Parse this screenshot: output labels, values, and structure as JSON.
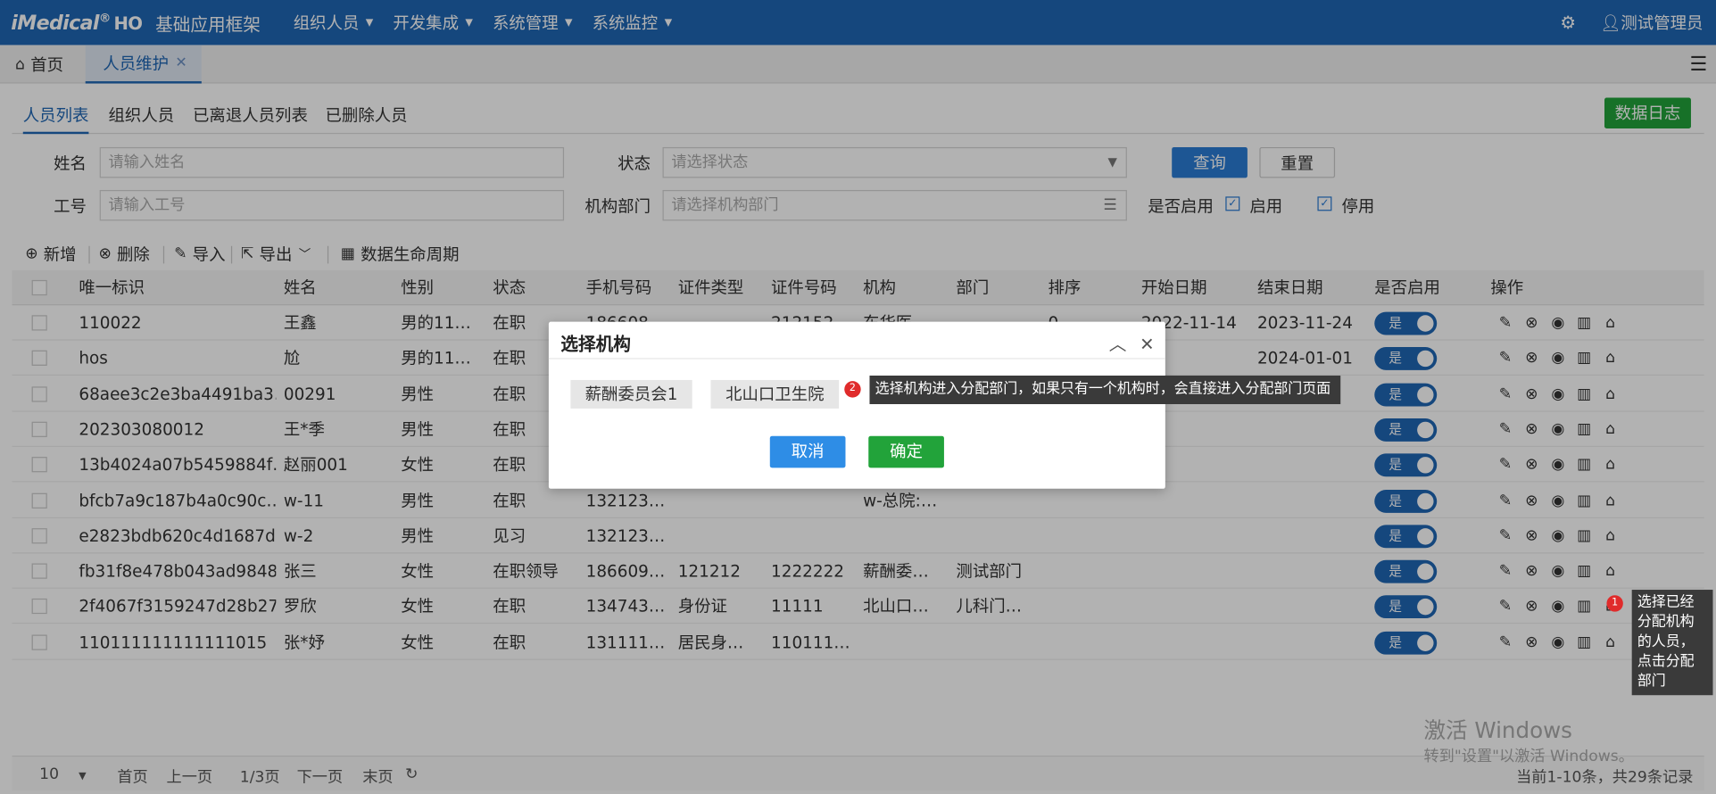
{
  "topbar": {
    "logo": "iMedical",
    "logo_reg": "®",
    "logo_ho": "HO",
    "app_name": "基础应用框架",
    "nav": [
      "组织人员",
      "开发集成",
      "系统管理",
      "系统监控"
    ],
    "user": "测试管理员"
  },
  "tabs": {
    "home": "首页",
    "active": "人员维护"
  },
  "subtabs": [
    "人员列表",
    "组织人员",
    "已离退人员列表",
    "已删除人员"
  ],
  "log_button": "数据日志",
  "search": {
    "name_label": "姓名",
    "name_placeholder": "请输入姓名",
    "status_label": "状态",
    "status_placeholder": "请选择状态",
    "query_button": "查询",
    "reset_button": "重置",
    "job_label": "工号",
    "job_placeholder": "请输入工号",
    "dept_label": "机构部门",
    "dept_placeholder": "请选择机构部门",
    "enabled_label": "是否启用",
    "opt_enabled": "启用",
    "opt_disabled": "停用"
  },
  "toolbar": {
    "add": "新增",
    "delete": "删除",
    "import": "导入",
    "export": "导出",
    "lifecycle": "数据生命周期"
  },
  "columns": [
    "唯一标识",
    "姓名",
    "性别",
    "状态",
    "手机号码",
    "证件类型",
    "证件号码",
    "机构",
    "部门",
    "排序",
    "开始日期",
    "结束日期",
    "是否启用",
    "操作"
  ],
  "rows": [
    {
      "id": "110022",
      "name": "王鑫",
      "gender": "男的11…",
      "status": "在职",
      "phone": "186608",
      "idtype": "",
      "idno": "212152",
      "org": "东华医",
      "dept": "",
      "sort": "0",
      "start": "2022-11-14",
      "end": "2023-11-24",
      "enabled": "是"
    },
    {
      "id": "hos",
      "name": "尬",
      "gender": "男的11…",
      "status": "在职",
      "phone": "",
      "idtype": "",
      "idno": "",
      "org": "",
      "dept": "",
      "sort": "",
      "start": "",
      "end": "2024-01-01",
      "enabled": "是"
    },
    {
      "id": "68aee3c2e3ba4491ba3…",
      "name": "00291",
      "gender": "男性",
      "status": "在职",
      "phone": "",
      "idtype": "",
      "idno": "",
      "org": "",
      "dept": "",
      "sort": "",
      "start": "",
      "end": "",
      "enabled": "是"
    },
    {
      "id": "202303080012",
      "name": "王*季",
      "gender": "男性",
      "status": "在职",
      "phone": "",
      "idtype": "",
      "idno": "",
      "org": "",
      "dept": "",
      "sort": "",
      "start": "",
      "end": "",
      "enabled": "是"
    },
    {
      "id": "13b4024a07b5459884f…",
      "name": "赵丽001",
      "gender": "女性",
      "status": "在职",
      "phone": "",
      "idtype": "",
      "idno": "",
      "org": "",
      "dept": "",
      "sort": "",
      "start": "",
      "end": "",
      "enabled": "是"
    },
    {
      "id": "bfcb7a9c187b4a0c90c…",
      "name": "w-11",
      "gender": "男性",
      "status": "在职",
      "phone": "132123…",
      "idtype": "",
      "idno": "",
      "org": "w-总院:…",
      "dept": "",
      "sort": "",
      "start": "",
      "end": "",
      "enabled": "是"
    },
    {
      "id": "e2823bdb620c4d1687d…",
      "name": "w-2",
      "gender": "男性",
      "status": "见习",
      "phone": "132123…",
      "idtype": "",
      "idno": "",
      "org": "",
      "dept": "",
      "sort": "",
      "start": "",
      "end": "",
      "enabled": "是"
    },
    {
      "id": "fb31f8e478b043ad9848…",
      "name": "张三",
      "gender": "女性",
      "status": "在职领导",
      "phone": "186609…",
      "idtype": "121212",
      "idno": "1222222",
      "org": "薪酬委…",
      "dept": "测试部门",
      "sort": "",
      "start": "",
      "end": "",
      "enabled": "是"
    },
    {
      "id": "2f4067f3159247d28b27…",
      "name": "罗欣",
      "gender": "女性",
      "status": "在职",
      "phone": "134743…",
      "idtype": "身份证",
      "idno": "11111",
      "org": "北山口…",
      "dept": "儿科门…",
      "sort": "",
      "start": "",
      "end": "",
      "enabled": "是"
    },
    {
      "id": "110111111111111015",
      "name": "张*妤",
      "gender": "女性",
      "status": "在职",
      "phone": "131111…",
      "idtype": "居民身…",
      "idno": "110111…",
      "org": "",
      "dept": "",
      "sort": "",
      "start": "",
      "end": "",
      "enabled": "是"
    }
  ],
  "pager": {
    "size": "10",
    "first": "首页",
    "prev": "上一页",
    "page": "1/3页",
    "next": "下一页",
    "last": "末页",
    "summary": "当前1-10条，共29条记录"
  },
  "watermark": {
    "line1": "激活 Windows",
    "line2": "转到\"设置\"以激活 Windows。"
  },
  "dialog": {
    "title": "选择机构",
    "orgs": [
      "薪酬委员会1",
      "北山口卫生院"
    ],
    "cancel": "取消",
    "confirm": "确定"
  },
  "tips": [
    {
      "badge": "2",
      "text": "选择机构进入分配部门，如果只有一个机构时，会直接进入分配部门页面"
    },
    {
      "badge": "1",
      "lines": [
        "选择已经",
        "分配机构",
        "的人员，",
        "点击分配",
        "部门"
      ]
    }
  ]
}
